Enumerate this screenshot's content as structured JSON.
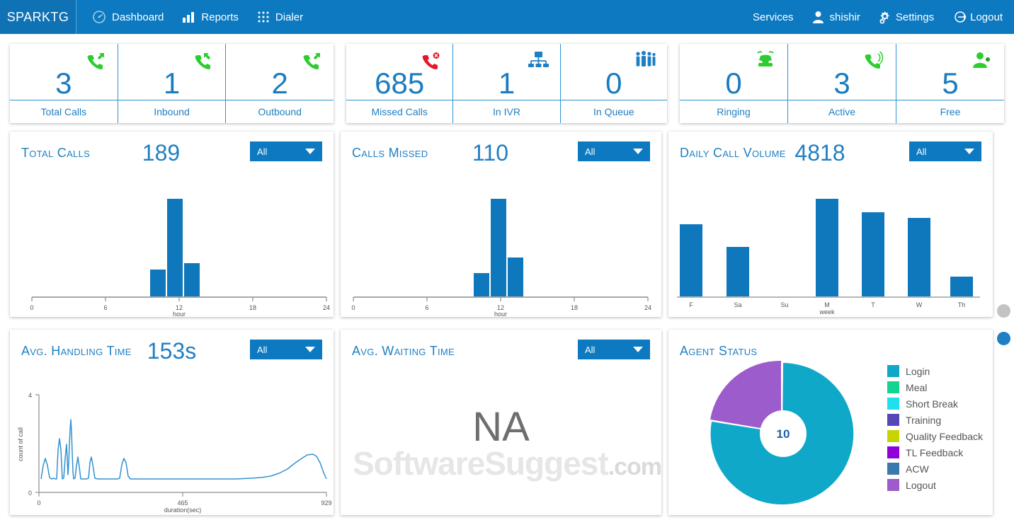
{
  "header": {
    "logo": "SPARKTG",
    "nav_left": [
      {
        "label": "Dashboard",
        "icon": "gauge-icon"
      },
      {
        "label": "Reports",
        "icon": "bar-chart-icon"
      },
      {
        "label": "Dialer",
        "icon": "keypad-icon"
      }
    ],
    "nav_right": [
      {
        "label": "Services",
        "icon": ""
      },
      {
        "label": "shishir",
        "icon": "user-icon"
      },
      {
        "label": "Settings",
        "icon": "gears-icon"
      },
      {
        "label": "Logout",
        "icon": "logout-icon"
      }
    ]
  },
  "stats": [
    {
      "value": "3",
      "label": "Total Calls",
      "icon": "phone-outgoing-icon",
      "icon_color": "#2ecc2e"
    },
    {
      "value": "1",
      "label": "Inbound",
      "icon": "phone-incoming-icon",
      "icon_color": "#2ecc2e"
    },
    {
      "value": "2",
      "label": "Outbound",
      "icon": "phone-outgoing-icon",
      "icon_color": "#2ecc2e"
    },
    {
      "value": "685",
      "label": "Missed Calls",
      "icon": "phone-missed-icon",
      "icon_color": "#e8152a"
    },
    {
      "value": "1",
      "label": "In IVR",
      "icon": "ivr-tree-icon",
      "icon_color": "#1e7fc4"
    },
    {
      "value": "0",
      "label": "In Queue",
      "icon": "people-queue-icon",
      "icon_color": "#1e7fc4"
    },
    {
      "value": "0",
      "label": "Ringing",
      "icon": "ringing-phone-icon",
      "icon_color": "#2ecc2e"
    },
    {
      "value": "3",
      "label": "Active",
      "icon": "phone-active-icon",
      "icon_color": "#2ecc2e"
    },
    {
      "value": "5",
      "label": "Free",
      "icon": "agent-free-icon",
      "icon_color": "#2ecc2e"
    }
  ],
  "cards": {
    "total_calls": {
      "title": "Total Calls",
      "value": "189",
      "filter": "All"
    },
    "calls_missed": {
      "title": "Calls Missed",
      "value": "110",
      "filter": "All"
    },
    "daily_volume": {
      "title": "Daily Call Volume",
      "value": "4818",
      "filter": "All"
    },
    "handling_time": {
      "title": "Avg. Handling Time",
      "value": "153s",
      "filter": "All"
    },
    "waiting_time": {
      "title": "Avg. Waiting Time",
      "value": "NA",
      "filter": "All"
    },
    "agent_status": {
      "title": "Agent Status",
      "center_value": "10"
    }
  },
  "agent_legend": [
    {
      "label": "Login",
      "color": "#0fa8c8"
    },
    {
      "label": "Meal",
      "color": "#13d492"
    },
    {
      "label": "Short Break",
      "color": "#20e0f0"
    },
    {
      "label": "Training",
      "color": "#5448b8"
    },
    {
      "label": "Quality Feedback",
      "color": "#c8d400"
    },
    {
      "label": "TL Feedback",
      "color": "#9000d8"
    },
    {
      "label": "ACW",
      "color": "#3c78b0"
    },
    {
      "label": "Logout",
      "color": "#9c5ccc"
    }
  ],
  "watermark": {
    "text": "SoftwareSuggest",
    "suffix": ".com"
  },
  "colors": {
    "brand_blue": "#0c79c0",
    "logo_blue": "#0f72b4",
    "value_blue": "#2080c3",
    "bar_blue": "#0f78bd",
    "line_blue": "#3391d0",
    "donut_login": "#0fa8c8",
    "donut_logout": "#9c5ccc"
  },
  "chart_data": [
    {
      "id": "total_calls",
      "type": "bar",
      "title": "Total Calls",
      "total": 189,
      "xlabel": "hour",
      "ylabel": "",
      "xlim": [
        0,
        24
      ],
      "xticks": [
        "0",
        "6",
        "12",
        "18",
        "24"
      ],
      "x": [
        10,
        11,
        12.5
      ],
      "values": [
        22,
        100,
        28
      ],
      "ylim": [
        0,
        110
      ],
      "grid": false,
      "legend": "none"
    },
    {
      "id": "calls_missed",
      "type": "bar",
      "title": "Calls Missed",
      "total": 110,
      "xlabel": "hour",
      "ylabel": "",
      "xlim": [
        0,
        24
      ],
      "xticks": [
        "0",
        "6",
        "12",
        "18",
        "24"
      ],
      "x": [
        10,
        11,
        12.5
      ],
      "values": [
        20,
        100,
        34
      ],
      "ylim": [
        0,
        110
      ],
      "grid": false,
      "legend": "none"
    },
    {
      "id": "daily_call_volume",
      "type": "bar",
      "title": "Daily Call Volume",
      "total": 4818,
      "xlabel": "week",
      "ylabel": "",
      "categories": [
        "F",
        "Sa",
        "Su",
        "M",
        "T",
        "W",
        "Th"
      ],
      "values": [
        74,
        52,
        0,
        100,
        86,
        80,
        21
      ],
      "ylim": [
        0,
        105
      ],
      "grid": false,
      "legend": "none"
    },
    {
      "id": "avg_handling_time",
      "type": "line",
      "title": "Avg. Handling Time",
      "summary_value": "153s",
      "xlabel": "duration(sec)",
      "ylabel": "count of call",
      "xlim": [
        0,
        929
      ],
      "xticks": [
        "0",
        "465",
        "929"
      ],
      "ylim": [
        0,
        4
      ],
      "yticks": [
        "0",
        "4"
      ],
      "grid": false,
      "legend": "none",
      "series": [
        {
          "name": "count of call",
          "x": [
            0,
            8,
            16,
            24,
            32,
            40,
            46,
            52,
            58,
            62,
            68,
            74,
            80,
            88,
            96,
            104,
            112,
            122,
            132,
            142,
            152,
            164,
            176,
            190,
            210,
            240,
            300,
            380,
            460,
            540,
            620,
            680,
            720,
            760,
            800,
            830,
            860,
            880,
            900,
            920,
            929
          ],
          "values": [
            0.55,
            1.05,
            0.62,
            0.58,
            0.6,
            1.9,
            0.9,
            1.45,
            0.85,
            2.6,
            0.95,
            1.1,
            0.6,
            0.58,
            0.58,
            1.15,
            0.58,
            0.58,
            0.58,
            0.58,
            0.58,
            1.2,
            0.6,
            0.58,
            0.58,
            0.58,
            0.58,
            0.58,
            0.58,
            0.6,
            0.62,
            0.7,
            0.85,
            1.05,
            1.25,
            1.32,
            1.3,
            1.18,
            0.9,
            0.62,
            0.58
          ]
        }
      ]
    },
    {
      "id": "agent_status",
      "type": "pie",
      "title": "Agent Status",
      "center_label": "10",
      "donut": true,
      "legend": "right",
      "labels": [
        "Login",
        "Meal",
        "Short Break",
        "Training",
        "Quality Feedback",
        "TL Feedback",
        "ACW",
        "Logout"
      ],
      "values": [
        8,
        0,
        0,
        0,
        0,
        0,
        0,
        2
      ],
      "colors": [
        "#0fa8c8",
        "#13d492",
        "#20e0f0",
        "#5448b8",
        "#c8d400",
        "#9000d8",
        "#3c78b0",
        "#9c5ccc"
      ]
    },
    {
      "id": "avg_waiting_time",
      "type": "table",
      "title": "Avg. Waiting Time",
      "value": "NA"
    }
  ]
}
